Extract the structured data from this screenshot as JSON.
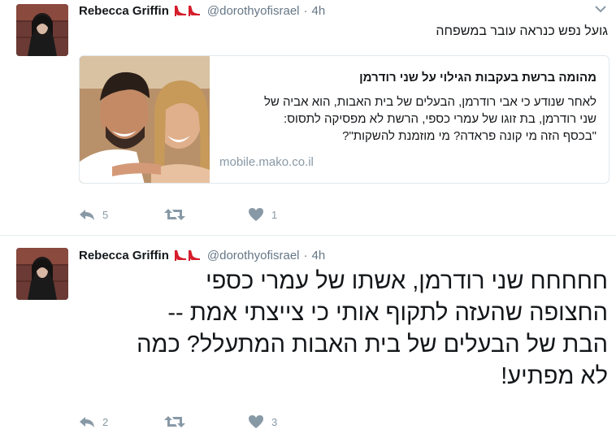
{
  "tweets": [
    {
      "author_name": "Rebecca Griffin",
      "handle": "@dorothyofisrael",
      "separator": "·",
      "time": "4h",
      "text": "גועל נפש כנראה עובר במשפחה",
      "card": {
        "title": "מהומה ברשת בעקבות הגילוי על שני רודרמן",
        "description_lines": [
          "לאחר שנודע כי אבי רודרמן, הבעלים של בית האבות, הוא אביה של",
          "שני רודרמן, בת זוגו של עמרי כספי, הרשת לא מפסיקה לתסוס:",
          "\"בכסף הזה מי קונה פראדה? מי מוזמנת להשקות\"?"
        ],
        "domain": "mobile.mako.co.il"
      },
      "actions": {
        "replies": "5",
        "retweets": "",
        "likes": "1"
      }
    },
    {
      "author_name": "Rebecca Griffin",
      "handle": "@dorothyofisrael",
      "separator": "·",
      "time": "4h",
      "text_lines": [
        "חחחחח שני רודרמן, אשתו של עמרי כספי",
        "החצופה שהעזה לתקוף אותי כי צייצתי אמת --",
        "הבת של הבעלים של בית האבות המתעלל? כמה",
        "לא מפתיע!"
      ],
      "actions": {
        "replies": "2",
        "retweets": "",
        "likes": "3"
      }
    }
  ],
  "icons": {
    "emoji": "high-heel-shoes-icon",
    "reply": "reply-icon",
    "retweet": "retweet-icon",
    "like": "heart-icon",
    "menu": "chevron-down-icon"
  },
  "colors": {
    "text": "#14171a",
    "secondary": "#657786",
    "action_gray": "#8899a6",
    "divider": "#e6ecf0",
    "heels": "#d61c2b"
  }
}
